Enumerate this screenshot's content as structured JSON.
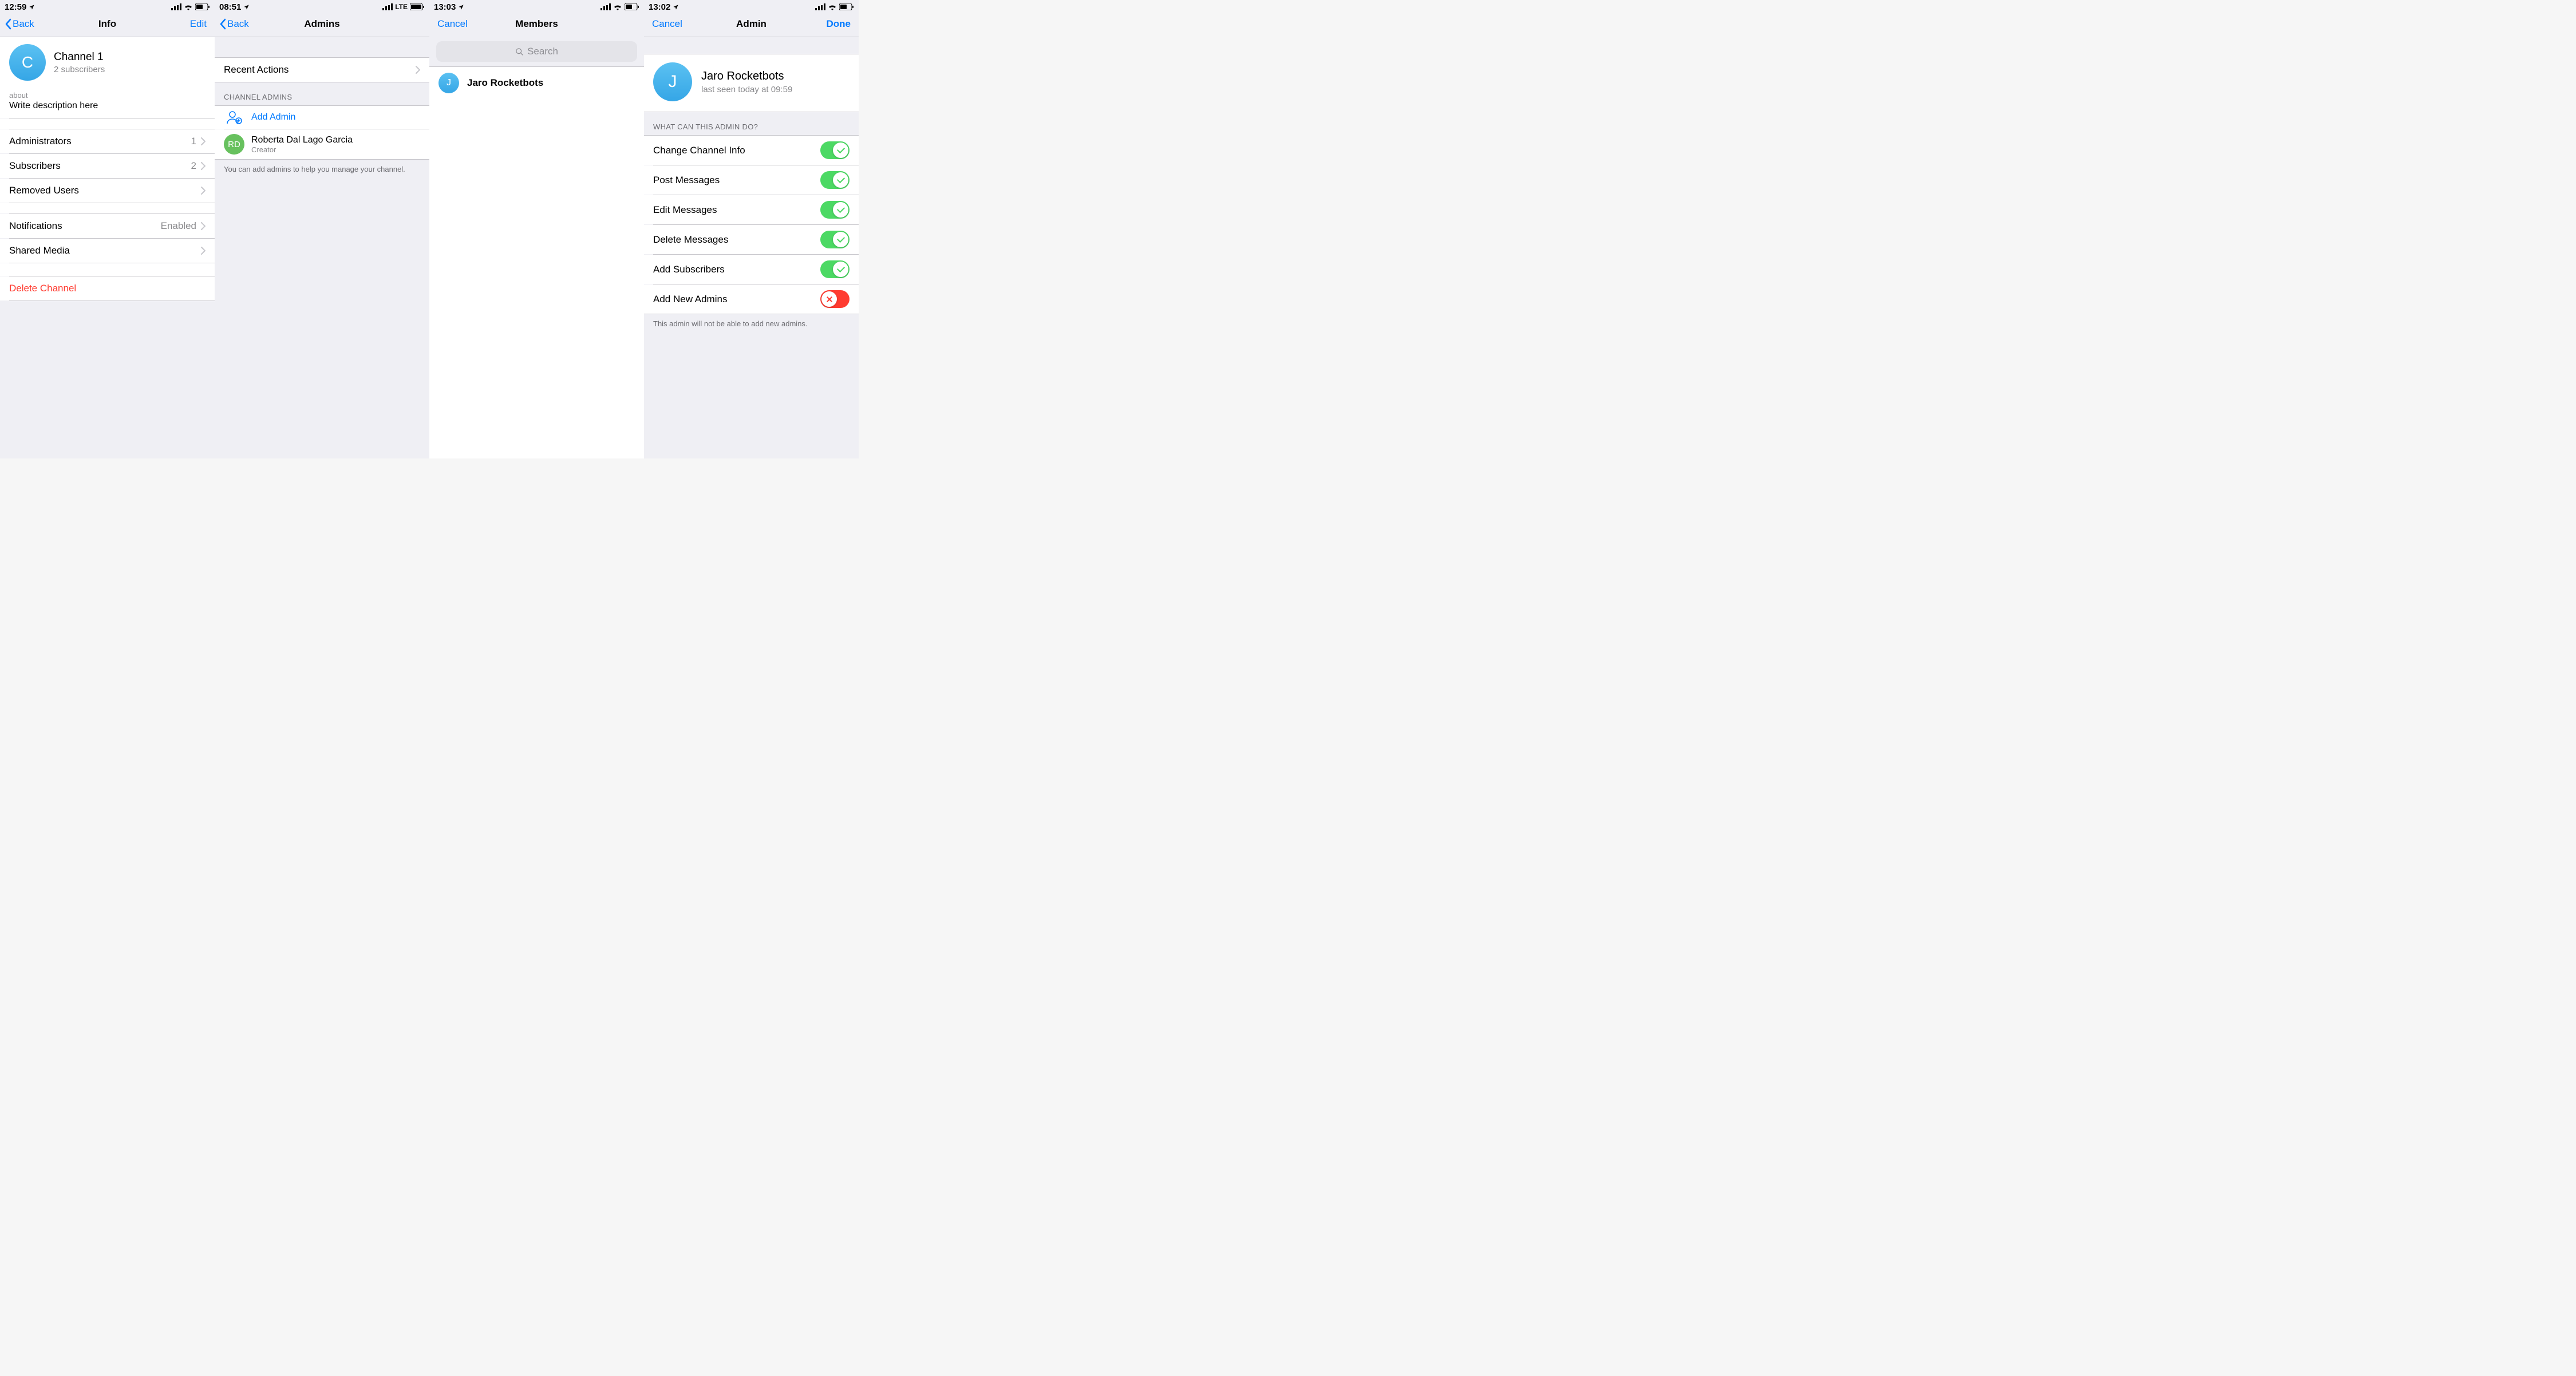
{
  "screens": [
    {
      "status": {
        "time": "12:59"
      },
      "nav": {
        "back": "Back",
        "title": "Info",
        "right": "Edit"
      },
      "channel": {
        "initial": "C",
        "name": "Channel 1",
        "subscribers": "2 subscribers"
      },
      "about": {
        "label": "about",
        "text": "Write description here"
      },
      "rows": {
        "administrators": {
          "label": "Administrators",
          "value": "1"
        },
        "subscribers": {
          "label": "Subscribers",
          "value": "2"
        },
        "removed": {
          "label": "Removed Users"
        },
        "notifications": {
          "label": "Notifications",
          "value": "Enabled"
        },
        "shared": {
          "label": "Shared Media"
        },
        "delete": {
          "label": "Delete Channel"
        }
      }
    },
    {
      "status": {
        "time": "08:51",
        "network": "LTE"
      },
      "nav": {
        "back": "Back",
        "title": "Admins"
      },
      "recent": "Recent Actions",
      "section_header": "CHANNEL ADMINS",
      "add_admin": "Add Admin",
      "admin": {
        "initials": "RD",
        "name_first": "Roberta",
        "name_rest": "Dal Lago Garcia",
        "role": "Creator"
      },
      "footer": "You can add admins to help you manage your channel."
    },
    {
      "status": {
        "time": "13:03"
      },
      "nav": {
        "left": "Cancel",
        "title": "Members"
      },
      "search_placeholder": "Search",
      "member": {
        "initial": "J",
        "name": "Jaro Rocketbots"
      }
    },
    {
      "status": {
        "time": "13:02"
      },
      "nav": {
        "left": "Cancel",
        "title": "Admin",
        "right": "Done"
      },
      "profile": {
        "initial": "J",
        "name": "Jaro Rocketbots",
        "status": "last seen today at 09:59"
      },
      "section_header": "WHAT CAN THIS ADMIN DO?",
      "permissions": {
        "change_info": "Change Channel Info",
        "post": "Post Messages",
        "edit": "Edit Messages",
        "delete": "Delete Messages",
        "add_sub": "Add Subscribers",
        "add_admins": "Add New Admins"
      },
      "footer": "This admin will not be able to add new admins."
    }
  ]
}
